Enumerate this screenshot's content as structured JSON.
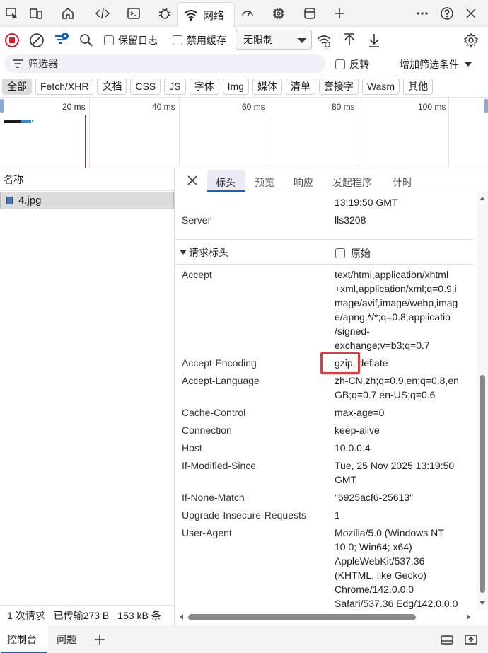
{
  "topbar": {
    "icons": [
      "inspect-icon",
      "device-emulation-icon",
      "welcome-home-icon",
      "elements-code-icon",
      "console-icon",
      "sources-bug-icon",
      "network-wifi-icon",
      "performance-gauge-icon",
      "memory-chip-icon",
      "application-window-icon",
      "add-tool-icon",
      "more-icon",
      "help-icon",
      "close-icon"
    ],
    "network_tab_label": "网络"
  },
  "toolbar": {
    "preserve_log_label": "保留日志",
    "disable_cache_label": "禁用缓存",
    "throttle_value": "无限制"
  },
  "filter": {
    "placeholder": "筛选器",
    "invert_label": "反转",
    "more_filters_label": "增加筛选条件"
  },
  "type_filters": [
    "全部",
    "Fetch/XHR",
    "文档",
    "CSS",
    "JS",
    "字体",
    "Img",
    "媒体",
    "清单",
    "套接字",
    "Wasm",
    "其他"
  ],
  "overview": {
    "ticks": [
      "20 ms",
      "40 ms",
      "60 ms",
      "80 ms",
      "100 ms"
    ]
  },
  "requests": {
    "header": "名称",
    "items": [
      {
        "name": "4.jpg"
      }
    ]
  },
  "status": {
    "requests": "1 次请求",
    "transferred": "已传输273 B",
    "resources": "153 kB 条"
  },
  "detail": {
    "tabs": [
      "标头",
      "预览",
      "响应",
      "发起程序",
      "计时"
    ],
    "response_tail": [
      {
        "key": "",
        "value": "13:19:50 GMT"
      },
      {
        "key": "Server",
        "value": "lls3208"
      }
    ],
    "request_section_title": "请求标头",
    "raw_label": "原始",
    "request_headers": [
      {
        "key": "Accept",
        "lines": [
          "text/html,application/xhtml",
          "+xml,application/xml;q=0.9,i",
          "mage/avif,image/webp,imag",
          "e/apng,*/*;q=0.8,applicatio",
          "/signed-",
          "exchange;v=b3;q=0.7"
        ]
      },
      {
        "key": "Accept-Encoding",
        "lines": [
          "gzip, deflate"
        ]
      },
      {
        "key": "Accept-Language",
        "lines": [
          "zh-CN,zh;q=0.9,en;q=0.8,en",
          "GB;q=0.7,en-US;q=0.6"
        ]
      },
      {
        "key": "Cache-Control",
        "lines": [
          "max-age=0"
        ]
      },
      {
        "key": "Connection",
        "lines": [
          "keep-alive"
        ]
      },
      {
        "key": "Host",
        "lines": [
          "10.0.0.4"
        ]
      },
      {
        "key": "If-Modified-Since",
        "lines": [
          "Tue, 25 Nov 2025 13:19:50",
          "GMT"
        ]
      },
      {
        "key": "If-None-Match",
        "lines": [
          "\"6925acf6-25613\""
        ]
      },
      {
        "key": "Upgrade-Insecure-Requests",
        "lines": [
          "1"
        ]
      },
      {
        "key": "User-Agent",
        "lines": [
          "Mozilla/5.0 (Windows NT",
          "10.0; Win64; x64)",
          "AppleWebKit/537.36",
          "(KHTML, like Gecko)",
          "Chrome/142.0.0.0",
          "Safari/537.36 Edg/142.0.0.0"
        ]
      }
    ]
  },
  "drawer": {
    "console_label": "控制台",
    "issues_label": "问题"
  }
}
